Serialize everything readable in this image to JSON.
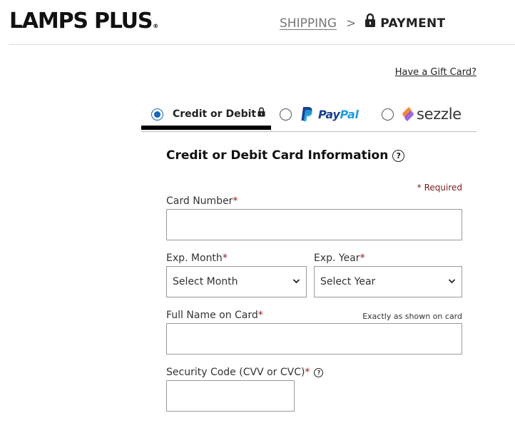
{
  "header": {
    "logo_text": "LAMPS PLUS",
    "logo_mark": "®",
    "steps": {
      "shipping": "SHIPPING",
      "separator": ">",
      "payment": "PAYMENT",
      "payment_icon": "lock-icon"
    }
  },
  "gift_card_link": "Have a Gift Card?",
  "payment_methods": {
    "selected": "credit",
    "credit": {
      "label": "Credit or Debit",
      "icon": "lock-icon"
    },
    "paypal": {
      "pay": "Pay",
      "pal": "Pal",
      "colors": {
        "pay": "#1b3f8f",
        "pal": "#1f9ed9"
      }
    },
    "sezzle": {
      "label": "sezzle"
    }
  },
  "form": {
    "title": "Credit or Debit Card Information",
    "help_glyph": "?",
    "required_note": "* Required",
    "required_star": "*",
    "card_number": {
      "label": "Card Number",
      "value": ""
    },
    "exp_month": {
      "label": "Exp. Month",
      "selected": "Select Month"
    },
    "exp_year": {
      "label": "Exp. Year",
      "selected": "Select Year"
    },
    "full_name": {
      "label": "Full Name on Card",
      "hint": "Exactly as shown on card",
      "value": ""
    },
    "security_code": {
      "label": "Security Code (CVV or CVC)",
      "value": ""
    }
  },
  "colors": {
    "accent": "#1767b4",
    "required": "#8b1a1a"
  }
}
